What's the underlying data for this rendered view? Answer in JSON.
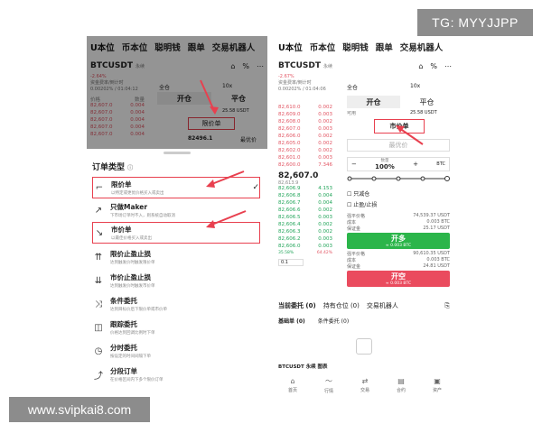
{
  "watermarks": {
    "top": "TG: MYYJJPP",
    "bottom": "www.svipkai8.com"
  },
  "nav_tabs": [
    "U本位",
    "币本位",
    "聪明钱",
    "跟单",
    "交易机器人"
  ],
  "symbol": {
    "name": "BTCUSDT",
    "tag": "永续",
    "change_left": "-2.64%",
    "change_right": "-2.67%"
  },
  "funding": {
    "label": "资金费率/倒计时",
    "value_left": "0.00202% / 01:04:12",
    "value_right": "0.00202% / 01:04:06"
  },
  "order_book_left": {
    "header": [
      "价格",
      "数量"
    ],
    "sells": [
      [
        "82,607.0",
        "0.004"
      ],
      [
        "82,607.0",
        "0.004"
      ],
      [
        "82,607.0",
        "0.004"
      ],
      [
        "82,607.0",
        "0.004"
      ],
      [
        "82,607.0",
        "0.004"
      ]
    ]
  },
  "trade_tabs": {
    "open": "开仓",
    "close": "平仓",
    "mode": "全仓",
    "leverage": "10x"
  },
  "left_fields": {
    "order_type": "限价单",
    "mark_price": "82496.1",
    "available": "25.58 USDT",
    "best_price": "最优价"
  },
  "sheet": {
    "title": "订单类型",
    "items": [
      {
        "name": "限价单",
        "desc": "以特定或更优价格买入或卖出",
        "icon": "limit-icon",
        "checked": true
      },
      {
        "name": "只做Maker",
        "desc": "下市场订单时不入，则系统自动取消",
        "icon": "maker-icon",
        "checked": false
      },
      {
        "name": "市价单",
        "desc": "以最佳价格买入或卖出",
        "icon": "market-icon",
        "checked": false
      },
      {
        "name": "限价止盈止损",
        "desc": "达到触发价时触发限价单",
        "icon": "limit-tpsl-icon",
        "checked": false
      },
      {
        "name": "市价止盈止损",
        "desc": "达到触发价时触发市价单",
        "icon": "market-tpsl-icon",
        "checked": false
      },
      {
        "name": "条件委托",
        "desc": "达到目标价后下限价单或市价单",
        "icon": "conditional-icon",
        "checked": false
      },
      {
        "name": "跟踪委托",
        "desc": "价格达到回调比例时下单",
        "icon": "trailing-icon",
        "checked": false
      },
      {
        "name": "分时委托",
        "desc": "按设定的时间间隔下单",
        "icon": "twap-icon",
        "checked": false
      },
      {
        "name": "分段订单",
        "desc": "在价格区间内下多个限价订单",
        "icon": "scaled-icon",
        "checked": false
      }
    ]
  },
  "right": {
    "available_label": "可用",
    "available": "25.58 USDT",
    "order_type": "市价单",
    "price_placeholder": "最优价",
    "qty_label": "数量",
    "qty_value": "100%",
    "qty_unit": "BTC",
    "reduce_only": "只减仓",
    "tpsl": "止盈/止损",
    "buy": {
      "label": "开多",
      "sub": "≈ 0.003 BTC"
    },
    "sell": {
      "label": "开空",
      "sub": "≈ 0.003 BTC"
    },
    "long_info": [
      [
        "强平价格",
        "74,539.37 USDT"
      ],
      [
        "成本",
        "0.003 BTC"
      ],
      [
        "保证金",
        "25.17 USDT"
      ]
    ],
    "short_info": [
      [
        "强平价格",
        "90,610.35 USDT"
      ],
      [
        "成本",
        "0.003 BTC"
      ],
      [
        "保证金",
        "24.81 USDT"
      ]
    ],
    "last_price": "82,607.0",
    "last_sub": "82,613.9",
    "sells": [
      [
        "82,610.0",
        "0.002"
      ],
      [
        "82,609.0",
        "0.003"
      ],
      [
        "82,608.0",
        "0.002"
      ],
      [
        "82,607.0",
        "0.003"
      ],
      [
        "82,606.0",
        "0.002"
      ],
      [
        "82,605.0",
        "0.002"
      ],
      [
        "82,602.0",
        "0.002"
      ],
      [
        "82,601.0",
        "0.003"
      ],
      [
        "82,600.0",
        "7.346"
      ]
    ],
    "buys": [
      [
        "82,606.9",
        "4.153"
      ],
      [
        "82,606.8",
        "0.004"
      ],
      [
        "82,606.7",
        "0.004"
      ],
      [
        "82,606.6",
        "0.002"
      ],
      [
        "82,606.5",
        "0.003"
      ],
      [
        "82,606.4",
        "0.002"
      ],
      [
        "82,606.3",
        "0.002"
      ],
      [
        "82,606.2",
        "0.003"
      ],
      [
        "82,606.0",
        "0.003"
      ]
    ],
    "ratio": {
      "buy": "35.58%",
      "sell": "64.42%"
    },
    "depth_step": "0.1",
    "bottom_tabs": [
      "当前委托 (0)",
      "持有仓位 (0)",
      "交易机器人"
    ],
    "sub_tabs": [
      "基础单 (0)",
      "条件委托 (0)"
    ],
    "chart_label": "BTCUSDT 永续 图表",
    "nav": [
      [
        "首页",
        "home-icon"
      ],
      [
        "行情",
        "market-icon"
      ],
      [
        "交易",
        "trade-icon"
      ],
      [
        "合约",
        "futures-icon"
      ],
      [
        "资产",
        "assets-icon"
      ]
    ]
  }
}
